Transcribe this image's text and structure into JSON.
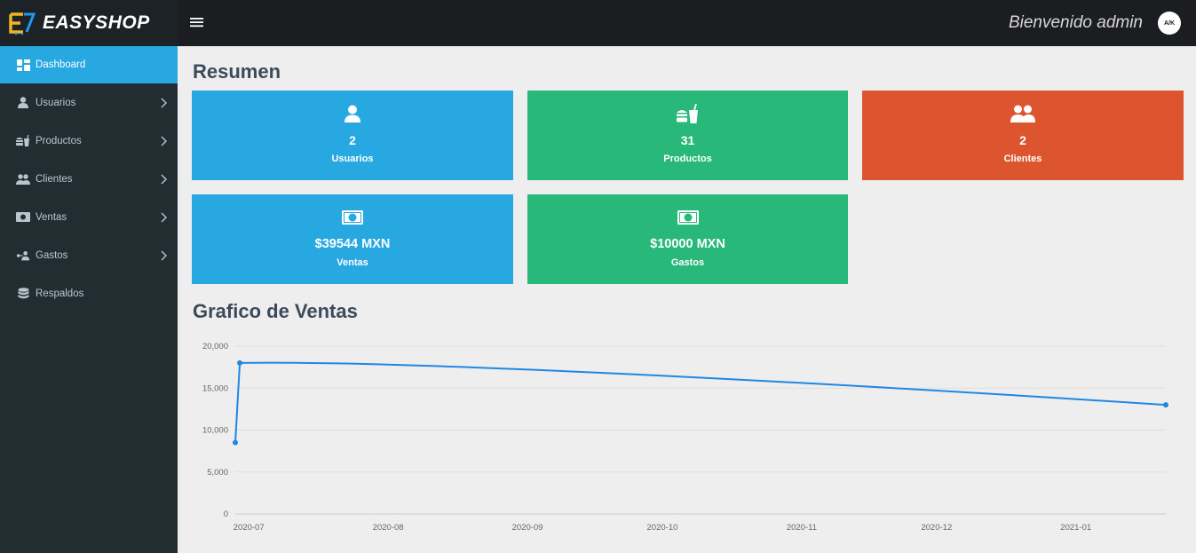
{
  "brand": {
    "name": "EASYSHOP",
    "logo_icon": "cart-logo-icon",
    "accent_color": "#f0b323"
  },
  "topbar": {
    "menu_icon": "hamburger-icon",
    "welcome": "Bienvenido admin",
    "avatar_text": "A/K"
  },
  "sidebar": {
    "items": [
      {
        "label": "Dashboard",
        "icon": "dashboard-icon",
        "active": true,
        "has_submenu": false
      },
      {
        "label": "Usuarios",
        "icon": "user-icon",
        "active": false,
        "has_submenu": true
      },
      {
        "label": "Productos",
        "icon": "food-icon",
        "active": false,
        "has_submenu": true
      },
      {
        "label": "Clientes",
        "icon": "users-icon",
        "active": false,
        "has_submenu": true
      },
      {
        "label": "Ventas",
        "icon": "money-icon",
        "active": false,
        "has_submenu": true
      },
      {
        "label": "Gastos",
        "icon": "people-carry-icon",
        "active": false,
        "has_submenu": true
      },
      {
        "label": "Respaldos",
        "icon": "database-icon",
        "active": false,
        "has_submenu": false
      }
    ]
  },
  "summary": {
    "title": "Resumen",
    "cards": [
      {
        "value": "2",
        "label": "Usuarios",
        "icon": "user-icon",
        "color": "#28a8e0"
      },
      {
        "value": "31",
        "label": "Productos",
        "icon": "food-icon",
        "color": "#28b87a"
      },
      {
        "value": "2",
        "label": "Clientes",
        "icon": "users-icon",
        "color": "#dc552f"
      },
      {
        "value": "$39544 MXN",
        "label": "Ventas",
        "icon": "money-icon",
        "color": "#28a8e0"
      },
      {
        "value": "$10000 MXN",
        "label": "Gastos",
        "icon": "money-icon",
        "color": "#28b87a"
      }
    ]
  },
  "sales_chart": {
    "title": "Grafico de Ventas"
  },
  "chart_data": {
    "type": "line",
    "title": "",
    "xlabel": "",
    "ylabel": "",
    "x_ticks": [
      "2020-07",
      "2020-08",
      "2020-09",
      "2020-10",
      "2020-11",
      "2020-12",
      "2021-01"
    ],
    "y_ticks": [
      "0",
      "5,000",
      "10,000",
      "15,000",
      "20,000"
    ],
    "ylim": [
      0,
      20000
    ],
    "xlim": [
      "2020-06-28",
      "2021-01-21"
    ],
    "grid": true,
    "series": [
      {
        "x": [
          "2020-06-28",
          "2020-06-29",
          "2021-01-21"
        ],
        "values": [
          8500,
          18000,
          13000
        ],
        "color": "#1e88e5"
      }
    ]
  }
}
